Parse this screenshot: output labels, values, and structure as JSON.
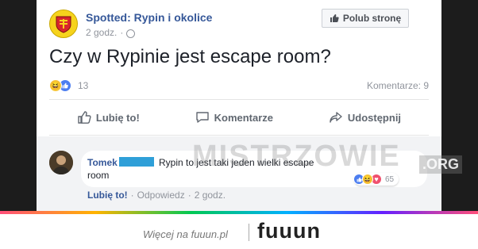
{
  "post": {
    "page_name": "Spotted: Rypin i okolice",
    "time": "2 godz.",
    "like_page_label": "Polub stronę",
    "text": "Czy w Rypinie jest escape room?",
    "reaction_count": "13",
    "comments_label": "Komentarze: 9"
  },
  "actions": {
    "like": "Lubię to!",
    "comment": "Komentarze",
    "share": "Udostępnij"
  },
  "comment": {
    "author": "Tomek",
    "text_line1": "Rypin to jest taki jeden wielki escape",
    "text_line2": "room",
    "reaction_count": "65",
    "like_label": "Lubię to!",
    "reply_label": "Odpowiedz",
    "time": "2 godz.",
    "sep": "·"
  },
  "watermark": {
    "text": "MISTRZOWIE",
    "tld": ".ORG"
  },
  "footer": {
    "text": "Więcej na fuuun.pl",
    "logo": "fuuun"
  },
  "colors": {
    "link": "#365899",
    "accent_like": "#4d7ef0",
    "censor": "#2f9fd8",
    "logo_accent": "#f4a700"
  }
}
